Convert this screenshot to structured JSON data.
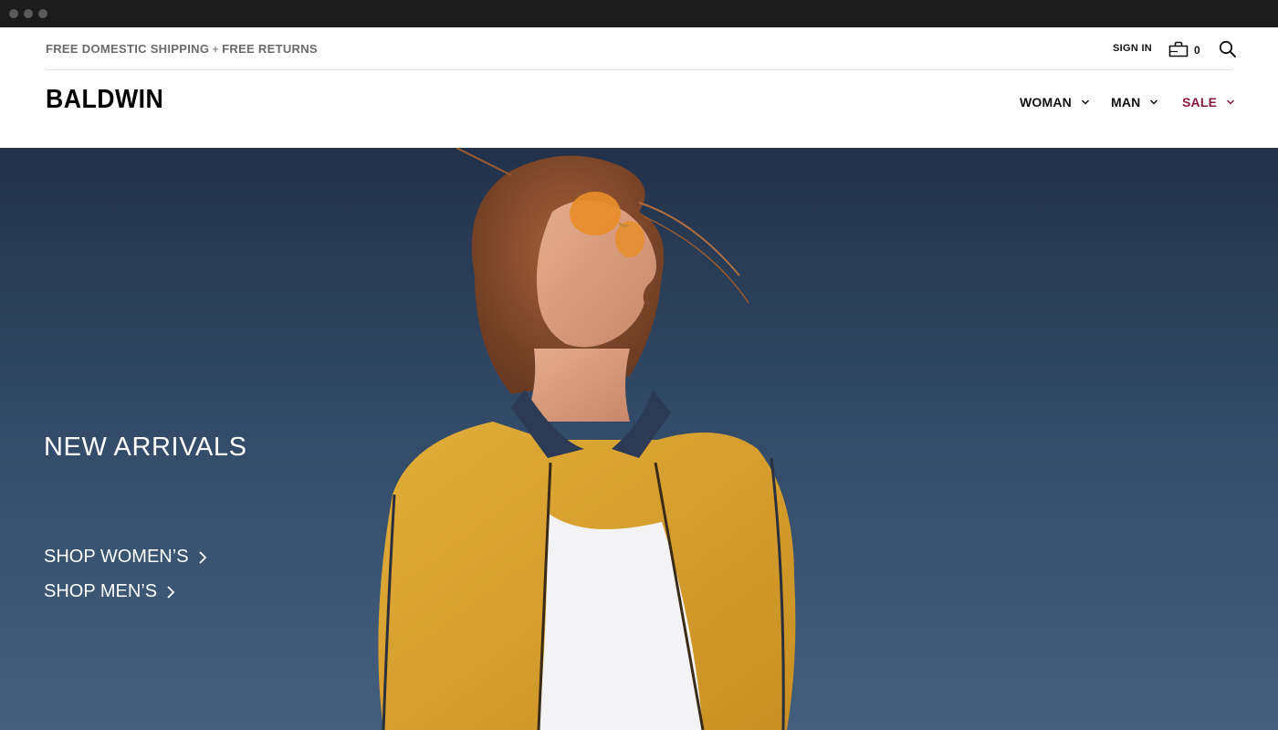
{
  "utility": {
    "promo_left": "FREE DOMESTIC SHIPPING",
    "promo_plus": "+",
    "promo_right": "FREE RETURNS",
    "sign_in": "SIGN IN",
    "bag_count": "0",
    "icons": {
      "bag": "shopping-bag-icon",
      "search": "search-icon"
    }
  },
  "header": {
    "logo": "BALDWIN",
    "nav": [
      {
        "label": "WOMAN"
      },
      {
        "label": "MAN"
      },
      {
        "label": "SALE"
      }
    ],
    "sale_color": "#8a1a44"
  },
  "hero": {
    "title": "NEW ARRIVALS",
    "links": [
      {
        "label": "SHOP WOMEN’S"
      },
      {
        "label": "SHOP MEN’S"
      }
    ]
  }
}
